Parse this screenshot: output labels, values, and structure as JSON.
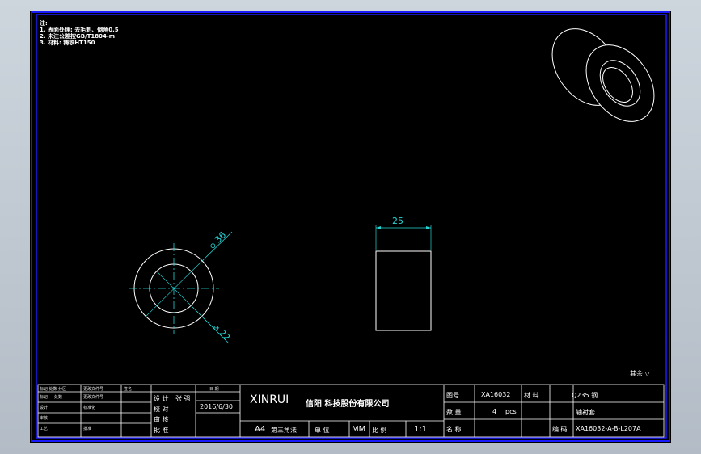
{
  "colors": {
    "background": "#000000",
    "frame": "#1a1aff",
    "geometry": "#ffffff",
    "dimension": "#23d5d5",
    "centerline": "#ff3030"
  },
  "notes": {
    "heading": "注:",
    "lines": [
      "1. 表面处理: 去毛刺、倒角0.5",
      "2. 未注公差按GB/T1804-m",
      "3. 材料: 铸铁HT150"
    ]
  },
  "dimensions": {
    "outer_diameter": "⌀ 36",
    "inner_diameter": "⌀ 22",
    "width": "25"
  },
  "title_block": {
    "left_headers": [
      "标记 处数 分区",
      "更改文件号",
      "签名",
      "年月日"
    ],
    "left_rows": [
      [
        "标记",
        "处数",
        "分区",
        "更改文件号"
      ],
      [
        "设计",
        "标准化",
        "",
        ""
      ],
      [
        "审核",
        "",
        "",
        ""
      ],
      [
        "工艺",
        "批准",
        "",
        ""
      ]
    ],
    "labels": {
      "design": "设 计",
      "check": "校 对",
      "review": "审 核",
      "approve": "批 准"
    },
    "designer": "张 强",
    "date_label": "日 期",
    "date": "2016/6/30",
    "company_en": "XINRUI",
    "company_cn": "信阳 科技股份有限公司",
    "paper_size": "A4",
    "sheet": "第三角法",
    "unit_label": "单 位",
    "unit": "MM",
    "scale_label": "比 例",
    "scale": "1:1",
    "drawing_no_label": "图号",
    "drawing_no": "XA16032",
    "material_label": "材 料",
    "material": "Q235 钢",
    "qty_label": "数 量",
    "qty": "4",
    "qty_unit": "pcs",
    "name_label": "名 称",
    "name": "轴衬套",
    "code_label": "编 码",
    "code": "XA16032-A-B-L207A",
    "roughness": "其余 ▽"
  }
}
